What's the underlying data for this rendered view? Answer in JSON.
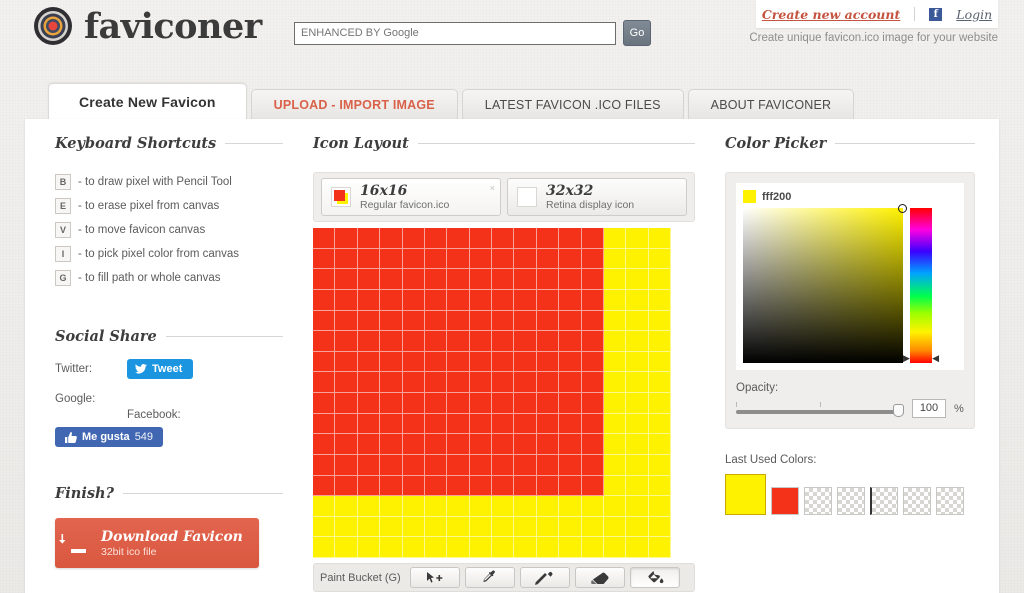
{
  "header": {
    "brand_name": "faviconer",
    "logo_icon": "faviconer-logo-icon",
    "search_placeholder": "ENHANCED BY Google",
    "search_value": "",
    "go_label": "Go",
    "create_account_label": "Create new account",
    "facebook_glyph": "f",
    "login_label": "Login",
    "tagline": "Create unique favicon.ico image for your website"
  },
  "tabs": [
    {
      "label": "Create New Favicon",
      "active": true
    },
    {
      "label": "UPLOAD - IMPORT IMAGE",
      "active": false
    },
    {
      "label": "LATEST FAVICON .ICO FILES",
      "active": false
    },
    {
      "label": "ABOUT FAVICONER",
      "active": false
    }
  ],
  "sidebar": {
    "shortcuts_title": "Keyboard Shortcuts",
    "shortcuts": [
      {
        "key": "B",
        "desc": "- to draw pixel with Pencil Tool"
      },
      {
        "key": "E",
        "desc": "- to erase pixel from canvas"
      },
      {
        "key": "V",
        "desc": "- to move favicon canvas"
      },
      {
        "key": "I",
        "desc": "- to pick pixel color from canvas"
      },
      {
        "key": "G",
        "desc": "- to fill path or whole canvas"
      }
    ],
    "social_title": "Social Share",
    "twitter_label": "Twitter:",
    "tweet_button": "Tweet",
    "google_label": "Google:",
    "facebook_label": "Facebook:",
    "like_button": "Me gusta",
    "like_count": "549",
    "finish_title": "Finish?",
    "download_title": "Download Favicon",
    "download_sub": "32bit ico file"
  },
  "icon_layout": {
    "title": "Icon Layout",
    "sizes": [
      {
        "name": "16x16",
        "desc": "Regular favicon.ico",
        "active": true,
        "has_preview": true,
        "close": "×"
      },
      {
        "name": "32x32",
        "desc": "Retina display icon",
        "active": false,
        "has_preview": false
      }
    ],
    "toolbar": {
      "current_tool": "Paint Bucket (G)",
      "tools": [
        {
          "name": "move-tool-icon",
          "active": false
        },
        {
          "name": "eyedropper-tool-icon",
          "active": false
        },
        {
          "name": "pencil-tool-icon",
          "active": false
        },
        {
          "name": "eraser-tool-icon",
          "active": false
        },
        {
          "name": "paint-bucket-tool-icon",
          "active": true
        }
      ]
    }
  },
  "canvas": {
    "cols": 16,
    "rows": 16,
    "red": "#f4321a",
    "yellow": "#fff200",
    "red_cols": 13,
    "red_rows": 13
  },
  "color_picker": {
    "title": "Color Picker",
    "hex_value": "fff200",
    "swatch_color": "#fff200",
    "opacity_label": "Opacity:",
    "opacity_value": "100",
    "opacity_unit": "%",
    "last_used_label": "Last Used Colors:",
    "last_used": [
      {
        "color": "#fff200",
        "empty": false,
        "selected": true
      },
      {
        "color": "#f4321a",
        "empty": false,
        "selected": false
      },
      {
        "color": "",
        "empty": true,
        "selected": false
      },
      {
        "color": "",
        "empty": true,
        "selected": false
      },
      {
        "color": "",
        "empty": true,
        "selected": false
      },
      {
        "color": "",
        "empty": true,
        "selected": false
      },
      {
        "color": "",
        "empty": true,
        "selected": false
      }
    ]
  }
}
